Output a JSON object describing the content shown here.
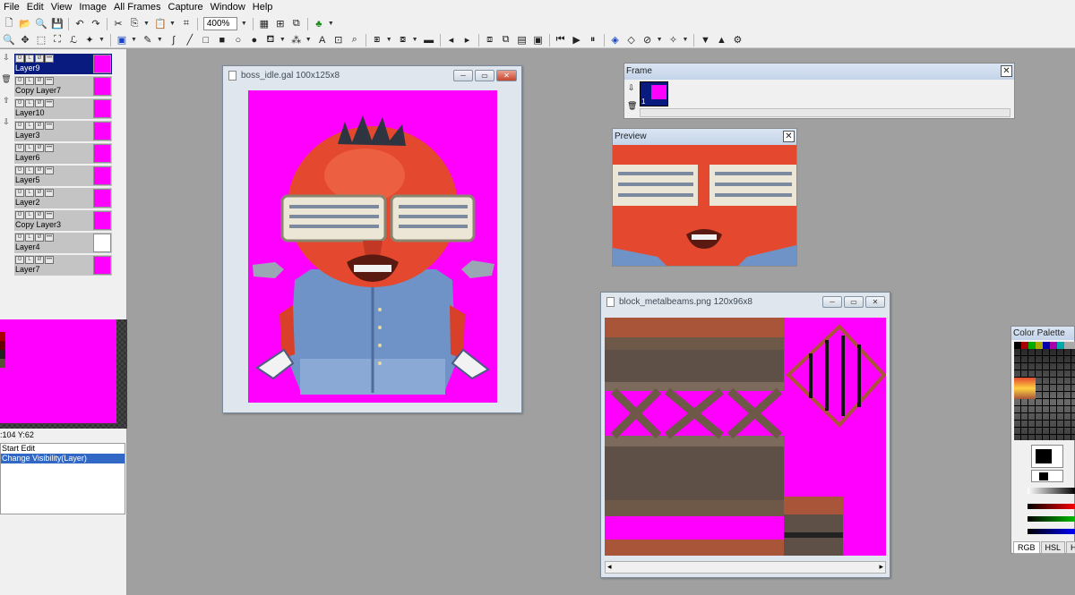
{
  "menu": [
    "File",
    "Edit",
    "View",
    "Image",
    "All Frames",
    "Capture",
    "Window",
    "Help"
  ],
  "toolbar": {
    "zoom": "400%"
  },
  "layers": [
    {
      "name": "Layer9",
      "selected": true
    },
    {
      "name": "Copy  Layer7",
      "selected": false
    },
    {
      "name": "Layer10",
      "selected": false
    },
    {
      "name": "Layer3",
      "selected": false
    },
    {
      "name": "Layer6",
      "selected": false
    },
    {
      "name": "Layer5",
      "selected": false
    },
    {
      "name": "Layer2",
      "selected": false
    },
    {
      "name": "Copy  Layer3",
      "selected": false
    },
    {
      "name": "Layer4",
      "selected": false
    },
    {
      "name": "Layer7",
      "selected": false
    }
  ],
  "status": {
    "coords": ":104 Y:62"
  },
  "history": [
    "Start Edit",
    "Change Visibility(Layer)"
  ],
  "windows": {
    "boss": {
      "title": "boss_idle.gal  100x125x8"
    },
    "block": {
      "title": "block_metalbeams.png  120x96x8"
    },
    "frame": {
      "title": "Frame",
      "frame_number": "1"
    },
    "preview": {
      "title": "Preview"
    },
    "palette": {
      "title": "Color Palette",
      "tabs": [
        "RGB",
        "HSL",
        "H"
      ]
    }
  },
  "colors": {
    "transparent": "#ff00ff",
    "selection": "#0a1b80",
    "history_sel": "#3168c6"
  }
}
